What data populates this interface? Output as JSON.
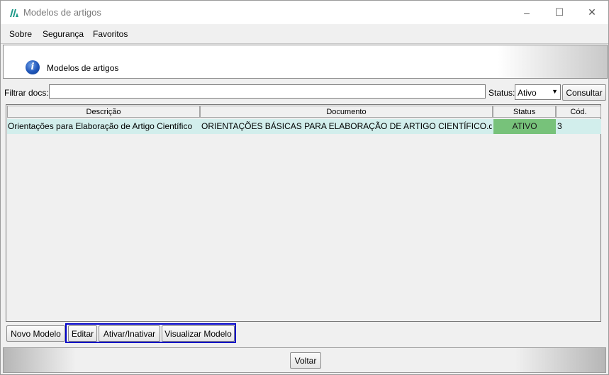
{
  "window": {
    "title": "Modelos de artigos",
    "controls": {
      "minimize": "–",
      "maximize": "☐",
      "close": "✕"
    }
  },
  "menu": [
    "Sobre",
    "Segurança",
    "Favoritos"
  ],
  "header": {
    "title": "Modelos de artigos",
    "icon": "info-icon"
  },
  "filter": {
    "label": "Filtrar docs:",
    "value": "",
    "status_label": "Status:",
    "status_value": "Ativo",
    "button": "Consultar"
  },
  "table": {
    "columns": [
      "Descrição",
      "Documento",
      "Status",
      "Cód."
    ],
    "rows": [
      {
        "descricao": "Orientações para Elaboração de Artigo Científico",
        "documento": "ORIENTAÇÕES BÁSICAS PARA ELABORAÇÃO DE ARTIGO CIENTÍFICO.docx",
        "status": "ATIVO",
        "cod": "3"
      }
    ]
  },
  "actions": {
    "new": "Novo Modelo",
    "edit": "Editar",
    "toggle": "Ativar/Inativar",
    "view": "Visualizar Modelo"
  },
  "footer": {
    "back": "Voltar"
  },
  "colors": {
    "status_active": "#77c27a",
    "row_selected": "#d2eeec",
    "highlight_border": "#0000c8"
  }
}
